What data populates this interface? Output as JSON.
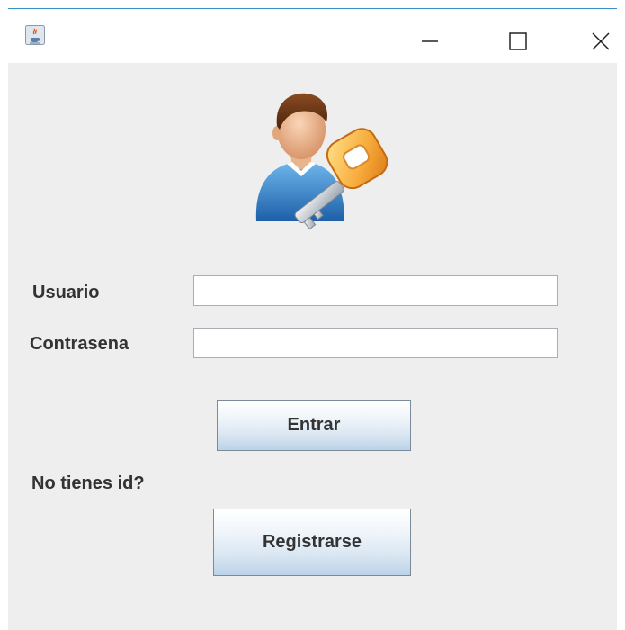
{
  "window": {
    "app_icon": "java-cup-icon",
    "controls": {
      "minimize_icon": "minimize-icon",
      "maximize_icon": "maximize-icon",
      "close_icon": "close-icon"
    },
    "accent_color": "#3a8fc7"
  },
  "login": {
    "illustration_icon": "user-key-icon",
    "username_label": "Usuario",
    "username_value": "",
    "password_label": "Contrasena",
    "password_value": "",
    "submit_label": "Entrar",
    "no_account_label": "No tienes id?",
    "register_label": "Registrarse"
  }
}
